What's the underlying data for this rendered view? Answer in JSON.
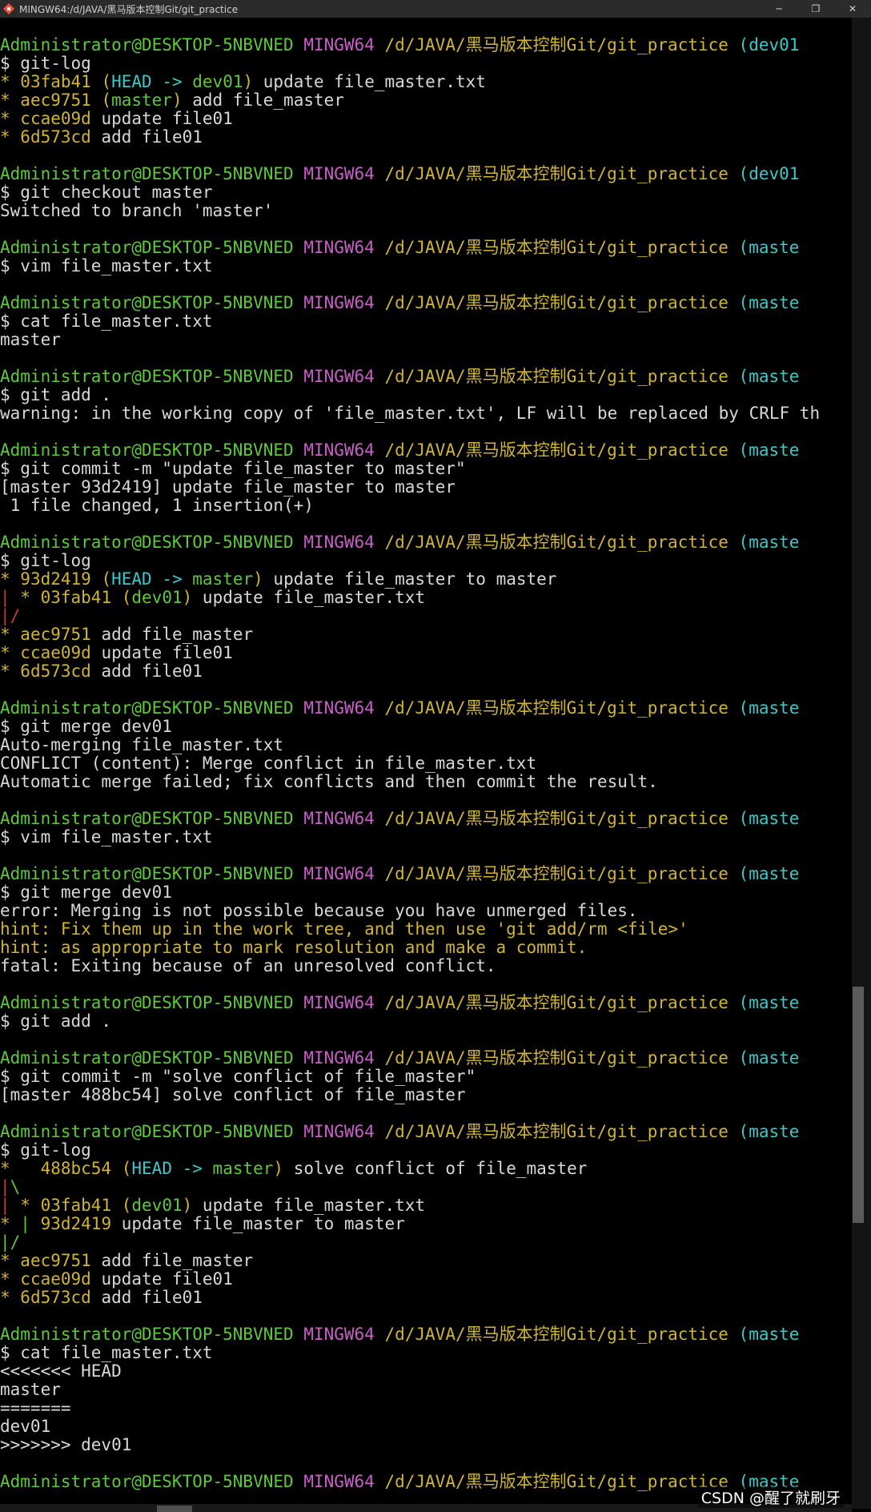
{
  "window": {
    "title": "MINGW64:/d/JAVA/黑马版本控制Git/git_practice",
    "minimize_glyph": "─",
    "maximize_glyph": "❐",
    "close_glyph": "✕",
    "app_icon": "git-bash-icon"
  },
  "watermark": "CSDN @醒了就刷牙",
  "colors": {
    "green": "#5ec93a",
    "purple": "#c860c8",
    "yellow": "#d0b436",
    "cyan": "#3cc8c8",
    "red": "#d13838",
    "white": "#d8d8d8",
    "hint": "#d0b436"
  },
  "lines": [
    [
      {
        "t": "Administrator@DESKTOP-5NBVNED",
        "c": "green"
      },
      {
        "t": " ",
        "c": "white"
      },
      {
        "t": "MINGW64",
        "c": "purple"
      },
      {
        "t": " /d/JAVA/黑马版本控制Git/git_practice",
        "c": "yellow"
      },
      {
        "t": " (dev01",
        "c": "cyan"
      }
    ],
    [
      {
        "t": "$ git-log",
        "c": "white"
      }
    ],
    [
      {
        "t": "* ",
        "c": "yellow"
      },
      {
        "t": "03fab41",
        "c": "yellow"
      },
      {
        "t": " (",
        "c": "yellow"
      },
      {
        "t": "HEAD -> ",
        "c": "cyan"
      },
      {
        "t": "dev01",
        "c": "green"
      },
      {
        "t": ")",
        "c": "yellow"
      },
      {
        "t": " update file_master.txt",
        "c": "white"
      }
    ],
    [
      {
        "t": "* ",
        "c": "yellow"
      },
      {
        "t": "aec9751",
        "c": "yellow"
      },
      {
        "t": " (",
        "c": "yellow"
      },
      {
        "t": "master",
        "c": "green"
      },
      {
        "t": ")",
        "c": "yellow"
      },
      {
        "t": " add file_master",
        "c": "white"
      }
    ],
    [
      {
        "t": "* ",
        "c": "yellow"
      },
      {
        "t": "ccae09d",
        "c": "yellow"
      },
      {
        "t": " update file01",
        "c": "white"
      }
    ],
    [
      {
        "t": "* ",
        "c": "yellow"
      },
      {
        "t": "6d573cd",
        "c": "yellow"
      },
      {
        "t": " add file01",
        "c": "white"
      }
    ],
    [],
    [
      {
        "t": "Administrator@DESKTOP-5NBVNED",
        "c": "green"
      },
      {
        "t": " ",
        "c": "white"
      },
      {
        "t": "MINGW64",
        "c": "purple"
      },
      {
        "t": " /d/JAVA/黑马版本控制Git/git_practice",
        "c": "yellow"
      },
      {
        "t": " (dev01",
        "c": "cyan"
      }
    ],
    [
      {
        "t": "$ git checkout master",
        "c": "white"
      }
    ],
    [
      {
        "t": "Switched to branch 'master'",
        "c": "white"
      }
    ],
    [],
    [
      {
        "t": "Administrator@DESKTOP-5NBVNED",
        "c": "green"
      },
      {
        "t": " ",
        "c": "white"
      },
      {
        "t": "MINGW64",
        "c": "purple"
      },
      {
        "t": " /d/JAVA/黑马版本控制Git/git_practice",
        "c": "yellow"
      },
      {
        "t": " (maste",
        "c": "cyan"
      }
    ],
    [
      {
        "t": "$ vim file_master.txt",
        "c": "white"
      }
    ],
    [],
    [
      {
        "t": "Administrator@DESKTOP-5NBVNED",
        "c": "green"
      },
      {
        "t": " ",
        "c": "white"
      },
      {
        "t": "MINGW64",
        "c": "purple"
      },
      {
        "t": " /d/JAVA/黑马版本控制Git/git_practice",
        "c": "yellow"
      },
      {
        "t": " (maste",
        "c": "cyan"
      }
    ],
    [
      {
        "t": "$ cat file_master.txt",
        "c": "white"
      }
    ],
    [
      {
        "t": "master",
        "c": "white"
      }
    ],
    [],
    [
      {
        "t": "Administrator@DESKTOP-5NBVNED",
        "c": "green"
      },
      {
        "t": " ",
        "c": "white"
      },
      {
        "t": "MINGW64",
        "c": "purple"
      },
      {
        "t": " /d/JAVA/黑马版本控制Git/git_practice",
        "c": "yellow"
      },
      {
        "t": " (maste",
        "c": "cyan"
      }
    ],
    [
      {
        "t": "$ git add .",
        "c": "white"
      }
    ],
    [
      {
        "t": "warning: in the working copy of 'file_master.txt', LF will be replaced by CRLF th",
        "c": "white"
      }
    ],
    [],
    [
      {
        "t": "Administrator@DESKTOP-5NBVNED",
        "c": "green"
      },
      {
        "t": " ",
        "c": "white"
      },
      {
        "t": "MINGW64",
        "c": "purple"
      },
      {
        "t": " /d/JAVA/黑马版本控制Git/git_practice",
        "c": "yellow"
      },
      {
        "t": " (maste",
        "c": "cyan"
      }
    ],
    [
      {
        "t": "$ git commit -m \"update file_master to master\"",
        "c": "white"
      }
    ],
    [
      {
        "t": "[master 93d2419] update file_master to master",
        "c": "white"
      }
    ],
    [
      {
        "t": " 1 file changed, 1 insertion(+)",
        "c": "white"
      }
    ],
    [],
    [
      {
        "t": "Administrator@DESKTOP-5NBVNED",
        "c": "green"
      },
      {
        "t": " ",
        "c": "white"
      },
      {
        "t": "MINGW64",
        "c": "purple"
      },
      {
        "t": " /d/JAVA/黑马版本控制Git/git_practice",
        "c": "yellow"
      },
      {
        "t": " (maste",
        "c": "cyan"
      }
    ],
    [
      {
        "t": "$ git-log",
        "c": "white"
      }
    ],
    [
      {
        "t": "* ",
        "c": "yellow"
      },
      {
        "t": "93d2419",
        "c": "yellow"
      },
      {
        "t": " (",
        "c": "yellow"
      },
      {
        "t": "HEAD -> ",
        "c": "cyan"
      },
      {
        "t": "master",
        "c": "green"
      },
      {
        "t": ")",
        "c": "yellow"
      },
      {
        "t": " update file_master to master",
        "c": "white"
      }
    ],
    [
      {
        "t": "| ",
        "c": "red"
      },
      {
        "t": "* ",
        "c": "yellow"
      },
      {
        "t": "03fab41",
        "c": "yellow"
      },
      {
        "t": " (",
        "c": "yellow"
      },
      {
        "t": "dev01",
        "c": "green"
      },
      {
        "t": ")",
        "c": "yellow"
      },
      {
        "t": " update file_master.txt",
        "c": "white"
      }
    ],
    [
      {
        "t": "|/",
        "c": "red"
      }
    ],
    [
      {
        "t": "* ",
        "c": "yellow"
      },
      {
        "t": "aec9751",
        "c": "yellow"
      },
      {
        "t": " add file_master",
        "c": "white"
      }
    ],
    [
      {
        "t": "* ",
        "c": "yellow"
      },
      {
        "t": "ccae09d",
        "c": "yellow"
      },
      {
        "t": " update file01",
        "c": "white"
      }
    ],
    [
      {
        "t": "* ",
        "c": "yellow"
      },
      {
        "t": "6d573cd",
        "c": "yellow"
      },
      {
        "t": " add file01",
        "c": "white"
      }
    ],
    [],
    [
      {
        "t": "Administrator@DESKTOP-5NBVNED",
        "c": "green"
      },
      {
        "t": " ",
        "c": "white"
      },
      {
        "t": "MINGW64",
        "c": "purple"
      },
      {
        "t": " /d/JAVA/黑马版本控制Git/git_practice",
        "c": "yellow"
      },
      {
        "t": " (maste",
        "c": "cyan"
      }
    ],
    [
      {
        "t": "$ git merge dev01",
        "c": "white"
      }
    ],
    [
      {
        "t": "Auto-merging file_master.txt",
        "c": "white"
      }
    ],
    [
      {
        "t": "CONFLICT (content): Merge conflict in file_master.txt",
        "c": "white"
      }
    ],
    [
      {
        "t": "Automatic merge failed; fix conflicts and then commit the result.",
        "c": "white"
      }
    ],
    [],
    [
      {
        "t": "Administrator@DESKTOP-5NBVNED",
        "c": "green"
      },
      {
        "t": " ",
        "c": "white"
      },
      {
        "t": "MINGW64",
        "c": "purple"
      },
      {
        "t": " /d/JAVA/黑马版本控制Git/git_practice",
        "c": "yellow"
      },
      {
        "t": " (maste",
        "c": "cyan"
      }
    ],
    [
      {
        "t": "$ vim file_master.txt",
        "c": "white"
      }
    ],
    [],
    [
      {
        "t": "Administrator@DESKTOP-5NBVNED",
        "c": "green"
      },
      {
        "t": " ",
        "c": "white"
      },
      {
        "t": "MINGW64",
        "c": "purple"
      },
      {
        "t": " /d/JAVA/黑马版本控制Git/git_practice",
        "c": "yellow"
      },
      {
        "t": " (maste",
        "c": "cyan"
      }
    ],
    [
      {
        "t": "$ git merge dev01",
        "c": "white"
      }
    ],
    [
      {
        "t": "error: Merging is not possible because you have unmerged files.",
        "c": "white"
      }
    ],
    [
      {
        "t": "hint: Fix them up in the work tree, and then use 'git add/rm <file>'",
        "c": "hint"
      }
    ],
    [
      {
        "t": "hint: as appropriate to mark resolution and make a commit.",
        "c": "hint"
      }
    ],
    [
      {
        "t": "fatal: Exiting because of an unresolved conflict.",
        "c": "white"
      }
    ],
    [],
    [
      {
        "t": "Administrator@DESKTOP-5NBVNED",
        "c": "green"
      },
      {
        "t": " ",
        "c": "white"
      },
      {
        "t": "MINGW64",
        "c": "purple"
      },
      {
        "t": " /d/JAVA/黑马版本控制Git/git_practice",
        "c": "yellow"
      },
      {
        "t": " (maste",
        "c": "cyan"
      }
    ],
    [
      {
        "t": "$ git add .",
        "c": "white"
      }
    ],
    [],
    [
      {
        "t": "Administrator@DESKTOP-5NBVNED",
        "c": "green"
      },
      {
        "t": " ",
        "c": "white"
      },
      {
        "t": "MINGW64",
        "c": "purple"
      },
      {
        "t": " /d/JAVA/黑马版本控制Git/git_practice",
        "c": "yellow"
      },
      {
        "t": " (maste",
        "c": "cyan"
      }
    ],
    [
      {
        "t": "$ git commit -m \"solve conflict of file_master\"",
        "c": "white"
      }
    ],
    [
      {
        "t": "[master 488bc54] solve conflict of file_master",
        "c": "white"
      }
    ],
    [],
    [
      {
        "t": "Administrator@DESKTOP-5NBVNED",
        "c": "green"
      },
      {
        "t": " ",
        "c": "white"
      },
      {
        "t": "MINGW64",
        "c": "purple"
      },
      {
        "t": " /d/JAVA/黑马版本控制Git/git_practice",
        "c": "yellow"
      },
      {
        "t": " (maste",
        "c": "cyan"
      }
    ],
    [
      {
        "t": "$ git-log",
        "c": "white"
      }
    ],
    [
      {
        "t": "*   ",
        "c": "yellow"
      },
      {
        "t": "488bc54",
        "c": "yellow"
      },
      {
        "t": " (",
        "c": "yellow"
      },
      {
        "t": "HEAD -> ",
        "c": "cyan"
      },
      {
        "t": "master",
        "c": "green"
      },
      {
        "t": ")",
        "c": "yellow"
      },
      {
        "t": " solve conflict of file_master",
        "c": "white"
      }
    ],
    [
      {
        "t": "|",
        "c": "red"
      },
      {
        "t": "\\",
        "c": "green"
      }
    ],
    [
      {
        "t": "| ",
        "c": "red"
      },
      {
        "t": "* ",
        "c": "yellow"
      },
      {
        "t": "03fab41",
        "c": "yellow"
      },
      {
        "t": " (",
        "c": "yellow"
      },
      {
        "t": "dev01",
        "c": "green"
      },
      {
        "t": ")",
        "c": "yellow"
      },
      {
        "t": " update file_master.txt",
        "c": "white"
      }
    ],
    [
      {
        "t": "* ",
        "c": "yellow"
      },
      {
        "t": "| ",
        "c": "green"
      },
      {
        "t": "93d2419",
        "c": "yellow"
      },
      {
        "t": " update file_master to master",
        "c": "white"
      }
    ],
    [
      {
        "t": "|/",
        "c": "green"
      }
    ],
    [
      {
        "t": "* ",
        "c": "yellow"
      },
      {
        "t": "aec9751",
        "c": "yellow"
      },
      {
        "t": " add file_master",
        "c": "white"
      }
    ],
    [
      {
        "t": "* ",
        "c": "yellow"
      },
      {
        "t": "ccae09d",
        "c": "yellow"
      },
      {
        "t": " update file01",
        "c": "white"
      }
    ],
    [
      {
        "t": "* ",
        "c": "yellow"
      },
      {
        "t": "6d573cd",
        "c": "yellow"
      },
      {
        "t": " add file01",
        "c": "white"
      }
    ],
    [],
    [
      {
        "t": "Administrator@DESKTOP-5NBVNED",
        "c": "green"
      },
      {
        "t": " ",
        "c": "white"
      },
      {
        "t": "MINGW64",
        "c": "purple"
      },
      {
        "t": " /d/JAVA/黑马版本控制Git/git_practice",
        "c": "yellow"
      },
      {
        "t": " (maste",
        "c": "cyan"
      }
    ],
    [
      {
        "t": "$ cat file_master.txt",
        "c": "white"
      }
    ],
    [
      {
        "t": "<<<<<<< HEAD",
        "c": "white"
      }
    ],
    [
      {
        "t": "master",
        "c": "white"
      }
    ],
    [
      {
        "t": "=======",
        "c": "white"
      }
    ],
    [
      {
        "t": "dev01",
        "c": "white"
      }
    ],
    [
      {
        "t": ">>>>>>> dev01",
        "c": "white"
      }
    ],
    [],
    [
      {
        "t": "Administrator@DESKTOP-5NBVNED",
        "c": "green"
      },
      {
        "t": " ",
        "c": "white"
      },
      {
        "t": "MINGW64",
        "c": "purple"
      },
      {
        "t": " /d/JAVA/黑马版本控制Git/git_practice",
        "c": "yellow"
      },
      {
        "t": " (maste",
        "c": "cyan"
      }
    ]
  ]
}
